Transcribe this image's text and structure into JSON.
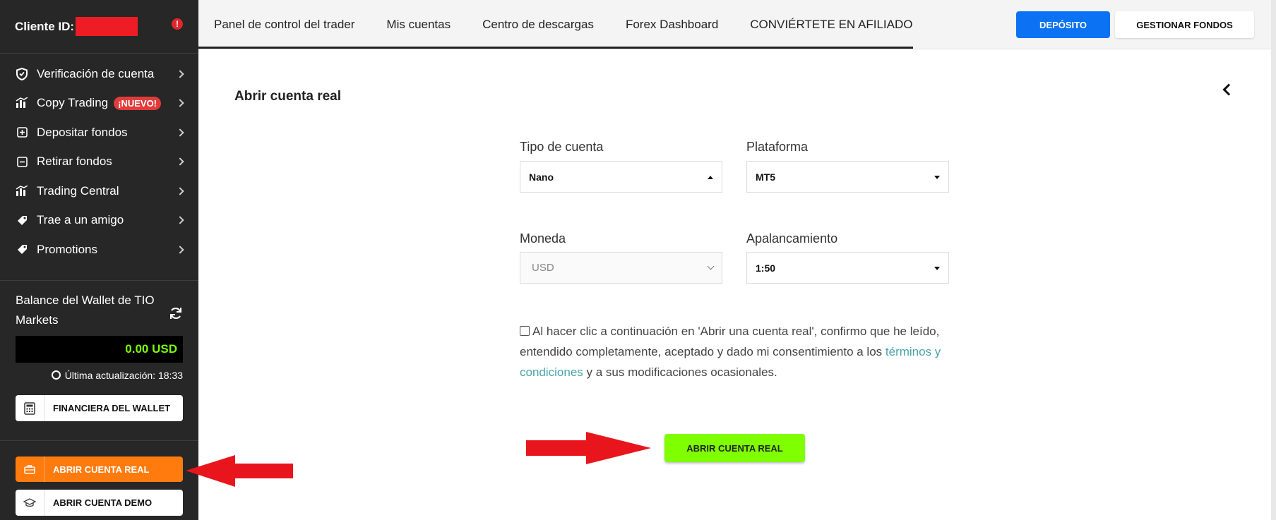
{
  "sidebar": {
    "client_label": "Cliente ID:",
    "alert_glyph": "!",
    "items": [
      {
        "label": "Verificación de cuenta",
        "icon": "shield-icon"
      },
      {
        "label": "Copy Trading",
        "icon": "chart-bars-icon",
        "badge": "¡NUEVO!"
      },
      {
        "label": "Depositar fondos",
        "icon": "plus-square-icon"
      },
      {
        "label": "Retirar fondos",
        "icon": "minus-square-icon"
      },
      {
        "label": "Trading Central",
        "icon": "chart-bars-icon"
      },
      {
        "label": "Trae a un amigo",
        "icon": "tag-icon"
      },
      {
        "label": "Promotions",
        "icon": "tag-icon"
      }
    ],
    "wallet": {
      "title": "Balance del Wallet de TIO Markets",
      "balance": "0.00 USD",
      "updated": "Última actualización: 18:33",
      "finance_button": "FINANCIERA DEL WALLET"
    },
    "open_real_button": "ABRIR CUENTA REAL",
    "open_demo_button": "ABRIR CUENTA DEMO"
  },
  "topnav": {
    "tabs": [
      "Panel de control del trader",
      "Mis cuentas",
      "Centro de descargas",
      "Forex Dashboard",
      "CONVIÉRTETE EN AFILIADO"
    ],
    "deposit_button": "DEPÓSITO",
    "manage_button": "GESTIONAR FONDOS"
  },
  "main": {
    "title": "Abrir cuenta real",
    "fields": {
      "account_type": {
        "label": "Tipo de cuenta",
        "value": "Nano"
      },
      "platform": {
        "label": "Plataforma",
        "value": "MT5"
      },
      "currency": {
        "label": "Moneda",
        "value": "USD"
      },
      "leverage": {
        "label": "Apalancamiento",
        "value": "1:50"
      }
    },
    "consent": {
      "text_before": "Al hacer clic a continuación en 'Abrir una cuenta real', confirmo que he leído, entendido completamente, aceptado y dado mi consentimiento a los ",
      "link": "términos y condiciones",
      "text_after": " y a sus modificaciones ocasionales."
    },
    "submit_button": "ABRIR CUENTA REAL"
  },
  "colors": {
    "sidebar_bg": "#272727",
    "primary_blue": "#0b72f3",
    "accent_green": "#7fff00",
    "accent_orange": "#ff7b0e",
    "annotation_red": "#e8161c",
    "link_teal": "#4aa3a8"
  }
}
